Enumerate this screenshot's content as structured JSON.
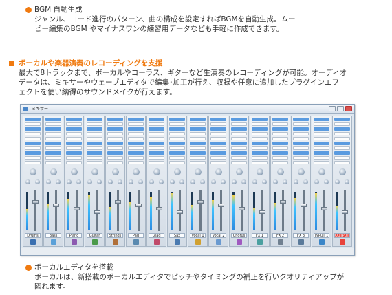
{
  "section1": {
    "title": "BGM 自動生成",
    "line1": "ジャンル、コード進行のパターン、曲の構成を設定すればBGMを自動生成。ムー",
    "line2": "ビー編集のBGM やマイナスワンの練習用データなども手軽に作成できます。"
  },
  "section2": {
    "title": "ボーカルや楽器演奏のレコーディングを支援",
    "line1": "最大で8トラックまで、ボーカルやコーラス、ギターなど生演奏のレコーディングが可能。オーディオ",
    "line2": "データは、ミキサーやウェーブエディタで編集･加工が行え、収録や任意に追加したプラグインエフ",
    "line3": "ェクトを使い納得のサウンドメイクが行えます。"
  },
  "mixer": {
    "window_title": "ミキサー",
    "channels": [
      "Drums",
      "Bass",
      "Piano",
      "Guitar",
      "Strings",
      "Pad",
      "Lead",
      "Sax",
      "Vocal 1",
      "Vocal 2",
      "Chorus",
      "FX 1",
      "FX 2",
      "FX 3",
      "INPUT 1",
      "OUTPUT 1"
    ]
  },
  "section3": {
    "title": "ボーカルエディタを搭載",
    "line1": "ボーカルは、新搭載のボーカルエディタでピッチやタイミングの補正を行いクオリティアップが",
    "line2": "図れます。"
  },
  "colors": {
    "accent": "#f07a10"
  }
}
